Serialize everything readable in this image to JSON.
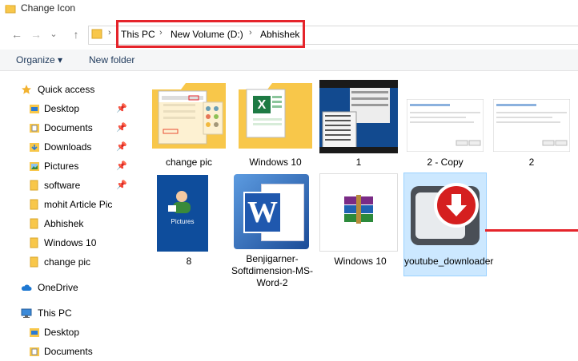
{
  "window": {
    "title": "Change Icon"
  },
  "nav_buttons": {
    "back": "←",
    "forward": "→",
    "dropdown": "⌄",
    "up": "↑"
  },
  "breadcrumb": {
    "separator": "›",
    "items": [
      "This PC",
      "New Volume (D:)",
      "Abhishek"
    ]
  },
  "toolbar": {
    "organize": "Organize ▾",
    "new_folder": "New folder"
  },
  "sidebar": {
    "items": [
      {
        "label": "Quick access",
        "icon": "star-icon",
        "pinned": false
      },
      {
        "label": "Desktop",
        "icon": "desktop-folder-icon",
        "pinned": true
      },
      {
        "label": "Documents",
        "icon": "documents-folder-icon",
        "pinned": true
      },
      {
        "label": "Downloads",
        "icon": "downloads-folder-icon",
        "pinned": true
      },
      {
        "label": "Pictures",
        "icon": "pictures-folder-icon",
        "pinned": true
      },
      {
        "label": "software",
        "icon": "folder-icon",
        "pinned": true
      },
      {
        "label": "mohit Article Pic",
        "icon": "folder-icon",
        "pinned": false
      },
      {
        "label": "Abhishek",
        "icon": "folder-icon",
        "pinned": false
      },
      {
        "label": "Windows 10",
        "icon": "folder-icon",
        "pinned": false
      },
      {
        "label": "change pic",
        "icon": "folder-icon",
        "pinned": false
      },
      {
        "label": "OneDrive",
        "icon": "cloud-icon",
        "pinned": false
      },
      {
        "label": "This PC",
        "icon": "computer-icon",
        "pinned": false
      },
      {
        "label": "Desktop",
        "icon": "desktop-folder-icon",
        "pinned": false
      },
      {
        "label": "Documents",
        "icon": "documents-folder-icon",
        "pinned": false
      }
    ],
    "pin_glyph": "📌"
  },
  "files": [
    {
      "label": "change pic",
      "kind": "folder-with-screenshot"
    },
    {
      "label": "Windows 10",
      "kind": "folder-with-excel"
    },
    {
      "label": "1",
      "kind": "screenshot-desktop"
    },
    {
      "label": "2 - Copy",
      "kind": "screenshot-dialog"
    },
    {
      "label": "2",
      "kind": "screenshot-dialog"
    },
    {
      "label": "8",
      "kind": "pictures-shortcut"
    },
    {
      "label": "Benjigarner-Softdimension-MS-Word-2",
      "kind": "word-icon"
    },
    {
      "label": "Windows 10",
      "kind": "winrar-icon"
    },
    {
      "label": "youtube_downloader",
      "kind": "youtube-downloader-icon",
      "selected": true
    }
  ],
  "thumb_texts": {
    "pictures": "Pictures",
    "word_letter": "W"
  },
  "colors": {
    "highlight": "#e5242b",
    "selection": "#cce8ff",
    "folder": "#f8c74a",
    "accent": "#0078d7"
  }
}
